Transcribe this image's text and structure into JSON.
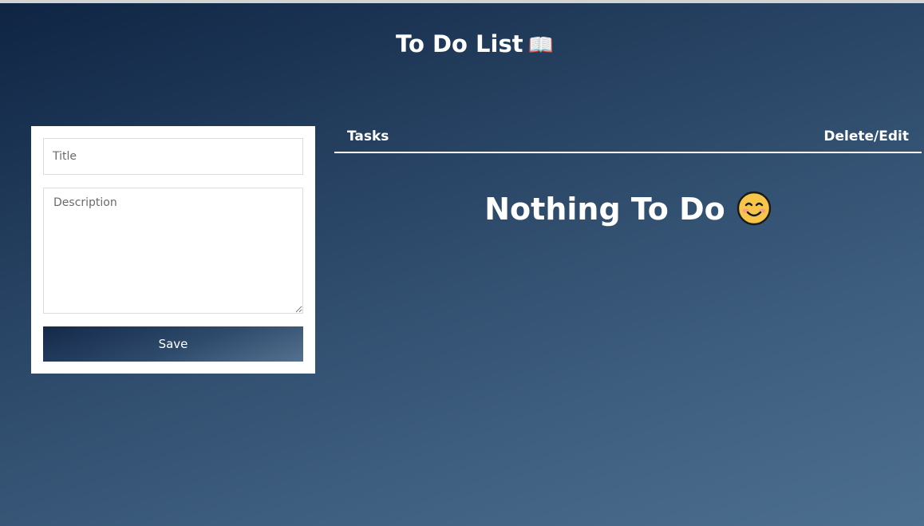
{
  "header": {
    "title": "To Do List",
    "title_emoji": "📖"
  },
  "form": {
    "title_placeholder": "Title",
    "description_placeholder": "Description",
    "save_label": "Save"
  },
  "tasks_table": {
    "columns": [
      "Tasks",
      "Delete/Edit"
    ],
    "empty_message": "Nothing To Do"
  },
  "icons": {
    "title_icon": "open-book-icon",
    "empty_icon": "smiling-face-icon"
  },
  "colors": {
    "background_start": "#0f2443",
    "background_end": "#4d6f8f",
    "card_background": "#ffffff",
    "emoji_face": "#f7c548"
  }
}
